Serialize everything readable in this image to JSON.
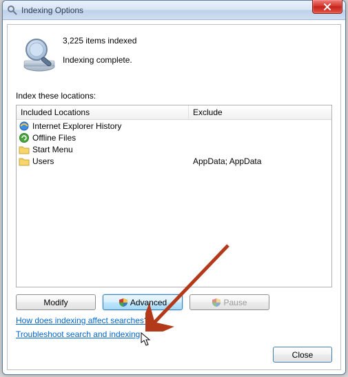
{
  "window": {
    "title": "Indexing Options"
  },
  "status": {
    "count_text": "3,225 items indexed",
    "state": "Indexing complete."
  },
  "section_label": "Index these locations:",
  "columns": {
    "included": "Included Locations",
    "exclude": "Exclude"
  },
  "rows": [
    {
      "icon": "ie",
      "name": "Internet Explorer History",
      "exclude": ""
    },
    {
      "icon": "sync",
      "name": "Offline Files",
      "exclude": ""
    },
    {
      "icon": "folder",
      "name": "Start Menu",
      "exclude": ""
    },
    {
      "icon": "folder",
      "name": "Users",
      "exclude": "AppData; AppData"
    }
  ],
  "buttons": {
    "modify": "Modify",
    "advanced": "Advanced",
    "pause": "Pause",
    "close": "Close"
  },
  "links": {
    "help": "How does indexing affect searches?",
    "troubleshoot": "Troubleshoot search and indexing"
  }
}
